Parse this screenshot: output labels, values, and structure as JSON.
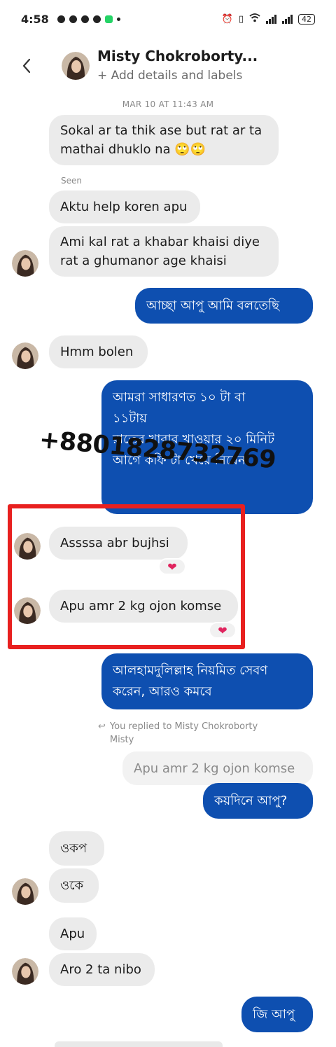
{
  "status_bar": {
    "time": "4:58",
    "battery": "42"
  },
  "header": {
    "contact_name": "Misty Chokroborty...",
    "subtitle": "+ Add details and labels"
  },
  "timestamp": "MAR 10 AT 11:43 AM",
  "seen_label": "Seen",
  "messages": [
    {
      "side": "in",
      "text": "Sokal ar ta thik ase but rat ar ta\nmathai dhuklo na 🙄🙄"
    },
    {
      "side": "in",
      "text": "Aktu help koren apu"
    },
    {
      "side": "in",
      "text": "Ami kal rat a khabar khaisi diye\nrat a ghumanor age khaisi"
    },
    {
      "side": "out",
      "text": "আচ্ছা আপু আমি বলতেছি"
    },
    {
      "side": "in",
      "text": "Hmm bolen"
    },
    {
      "side": "out",
      "text": "আমরা সাধারণত ১০ টা বা\n১১টায়\nরাতের খাবার খাওয়ার ২০ মিনিট\nআগে কফি টা খেয়ে নিবেন"
    },
    {
      "side": "in",
      "text": "Assssa abr bujhsi",
      "reaction": "❤"
    },
    {
      "side": "in",
      "text": "Apu amr 2 kg ojon komse",
      "reaction": "❤"
    },
    {
      "side": "out",
      "text": "আলহামদুলিল্লাহ নিয়মিত সেবণ\nকরেন, আরও কমবে"
    },
    {
      "side": "out",
      "text": "কয়দিনে আপু?"
    },
    {
      "side": "in",
      "text": "ওকপ"
    },
    {
      "side": "in",
      "text": "ওকে"
    },
    {
      "side": "in",
      "text": "Apu"
    },
    {
      "side": "in",
      "text": "Aro 2 ta nibo"
    },
    {
      "side": "out",
      "text": "জি আপু"
    }
  ],
  "reply_note": {
    "line1": "You replied to Misty Chokroborty",
    "line2": "Misty",
    "quoted_text": "Apu amr 2 kg ojon komse"
  },
  "watermark": "+8801828732769",
  "colors": {
    "outgoing_bubble": "#0e4fb0",
    "incoming_bubble": "#ebebeb",
    "highlight_border": "#e8201f",
    "reaction_heart": "#e0245e"
  }
}
